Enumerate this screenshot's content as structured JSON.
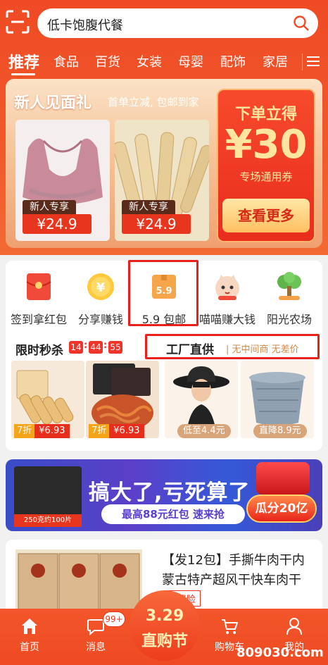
{
  "search": {
    "placeholder": "低卡饱腹代餐"
  },
  "tabs": [
    "推荐",
    "食品",
    "百货",
    "女装",
    "母婴",
    "配饰",
    "家居"
  ],
  "promo": {
    "title": "新人见面礼",
    "subtitle": "首单立减, 包邮到家",
    "products": [
      {
        "tag": "新人专享",
        "price": "¥24.9"
      },
      {
        "tag": "新人专享",
        "price": "¥24.9"
      }
    ],
    "coupon": {
      "line1": "下单立得",
      "amount": "¥30",
      "line2": "专场通用券",
      "button": "查看更多"
    }
  },
  "quick_links": [
    {
      "label": "签到拿红包",
      "icon": "red-envelope-icon"
    },
    {
      "label": "分享赚钱",
      "icon": "yen-coin-icon"
    },
    {
      "label": "5.9 包邮",
      "icon": "package-box-icon",
      "icon_text": "5.9"
    },
    {
      "label": "喵喵赚大钱",
      "icon": "lucky-cat-icon"
    },
    {
      "label": "阳光农场",
      "icon": "tree-icon"
    }
  ],
  "flash_sale": {
    "title": "限时秒杀",
    "countdown": [
      "14",
      "44",
      "55"
    ],
    "items": [
      {
        "discount": "7折",
        "price": "¥6.93"
      },
      {
        "discount": "7折",
        "price": "¥6.93"
      }
    ]
  },
  "factory": {
    "title": "工厂直供",
    "subtitle": "| 无中间商 无差价",
    "items": [
      {
        "tag": "低至4.4元"
      },
      {
        "tag": "直降8.9元"
      }
    ]
  },
  "banner": {
    "title": "搞大了,亏死算了",
    "button": "最高88元红包 速来抢",
    "badge": "瓜分20亿",
    "pack_label": "250克约100片"
  },
  "feed": {
    "title": "【发12包】手撕牛肉干内蒙古特产超风干快车肉干",
    "tag": "运费险"
  },
  "bottom_nav": [
    {
      "label": "首页",
      "icon": "home-icon"
    },
    {
      "label": "消息",
      "icon": "message-icon"
    },
    {
      "label": "购物车",
      "icon": "cart-icon"
    },
    {
      "label": "我的",
      "icon": "user-icon"
    }
  ],
  "message_badge": "99+",
  "festival": {
    "date": "3.29",
    "name": "直购节"
  },
  "watermark": "809030.com",
  "colors": {
    "brand": "#ef4a25",
    "highlight": "#e8211a",
    "banner": "#4a3fc8"
  }
}
